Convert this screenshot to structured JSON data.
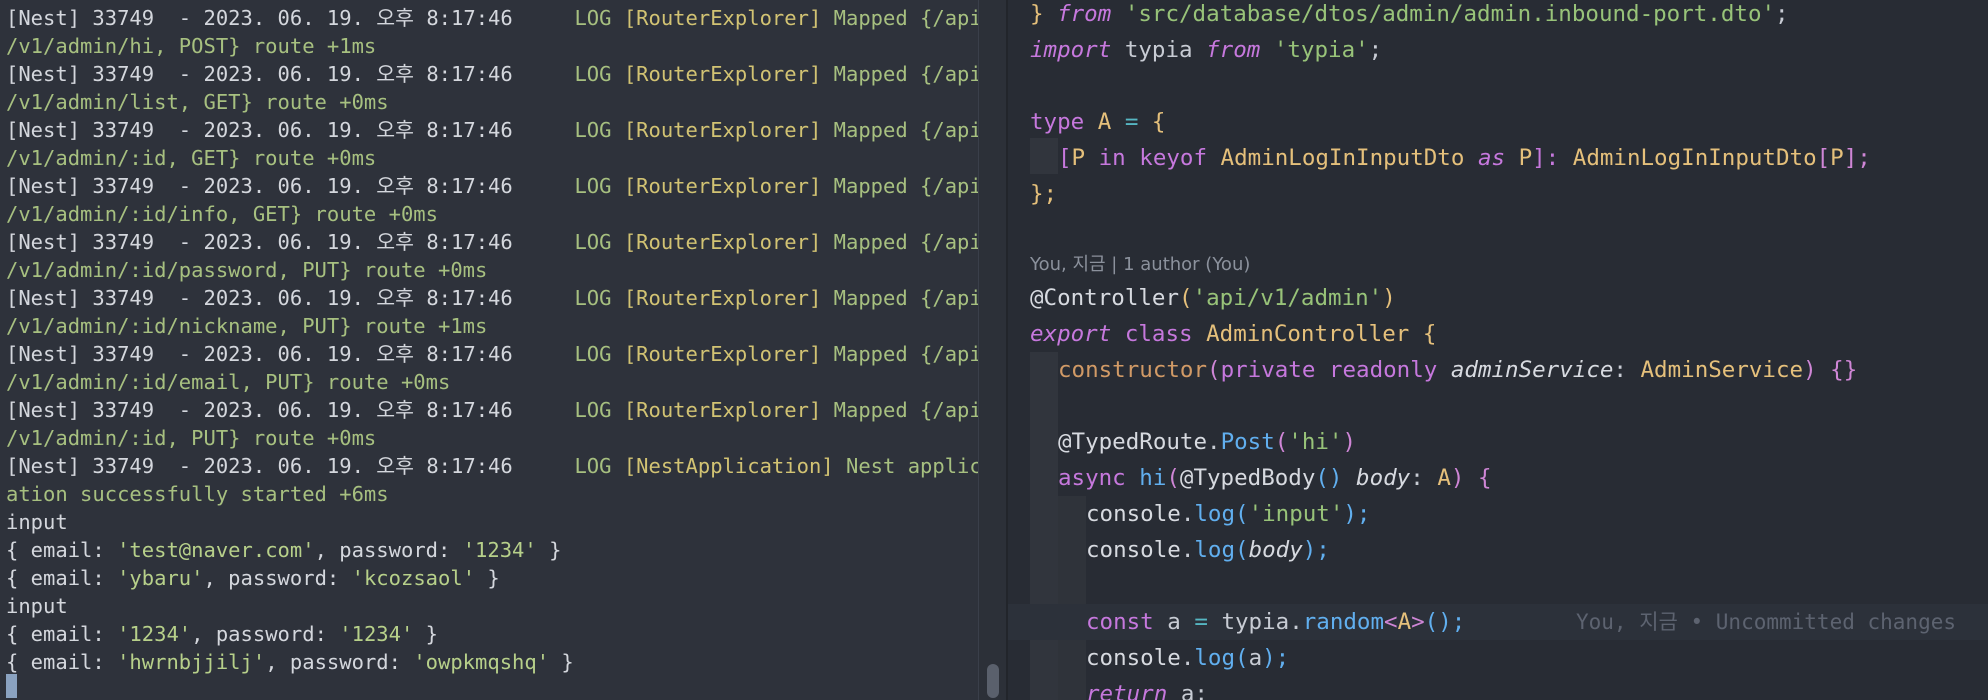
{
  "terminal": {
    "log_lines": [
      {
        "prefix": "[Nest] 33749  - 2023. 06. 19. 오후 8:17:46     ",
        "level": "LOG ",
        "context": "[RouterExplorer]",
        "msg": " Mapped {/api"
      },
      {
        "plain": "/v1/admin/hi, POST} route +1ms"
      },
      {
        "prefix": "[Nest] 33749  - 2023. 06. 19. 오후 8:17:46     ",
        "level": "LOG ",
        "context": "[RouterExplorer]",
        "msg": " Mapped {/api"
      },
      {
        "plain": "/v1/admin/list, GET} route +0ms"
      },
      {
        "prefix": "[Nest] 33749  - 2023. 06. 19. 오후 8:17:46     ",
        "level": "LOG ",
        "context": "[RouterExplorer]",
        "msg": " Mapped {/api"
      },
      {
        "plain": "/v1/admin/:id, GET} route +0ms"
      },
      {
        "prefix": "[Nest] 33749  - 2023. 06. 19. 오후 8:17:46     ",
        "level": "LOG ",
        "context": "[RouterExplorer]",
        "msg": " Mapped {/api"
      },
      {
        "plain": "/v1/admin/:id/info, GET} route +0ms"
      },
      {
        "prefix": "[Nest] 33749  - 2023. 06. 19. 오후 8:17:46     ",
        "level": "LOG ",
        "context": "[RouterExplorer]",
        "msg": " Mapped {/api"
      },
      {
        "plain": "/v1/admin/:id/password, PUT} route +0ms"
      },
      {
        "prefix": "[Nest] 33749  - 2023. 06. 19. 오후 8:17:46     ",
        "level": "LOG ",
        "context": "[RouterExplorer]",
        "msg": " Mapped {/api"
      },
      {
        "plain": "/v1/admin/:id/nickname, PUT} route +1ms"
      },
      {
        "prefix": "[Nest] 33749  - 2023. 06. 19. 오후 8:17:46     ",
        "level": "LOG ",
        "context": "[RouterExplorer]",
        "msg": " Mapped {/api"
      },
      {
        "plain": "/v1/admin/:id/email, PUT} route +0ms"
      },
      {
        "prefix": "[Nest] 33749  - 2023. 06. 19. 오후 8:17:46     ",
        "level": "LOG ",
        "context": "[RouterExplorer]",
        "msg": " Mapped {/api"
      },
      {
        "plain": "/v1/admin/:id, PUT} route +0ms"
      },
      {
        "prefix": "[Nest] 33749  - 2023. 06. 19. 오후 8:17:46     ",
        "level": "LOG ",
        "context": "[NestApplication]",
        "msg": " Nest applic"
      },
      {
        "plain": "ation successfully started +6ms"
      }
    ],
    "output": {
      "input1": "input",
      "obj1": {
        "open": "{ email: ",
        "email": "'test@naver.com'",
        "mid": ", password: ",
        "pw": "'1234'",
        "close": " }"
      },
      "obj2": {
        "open": "{ email: ",
        "email": "'ybaru'",
        "mid": ", password: ",
        "pw": "'kcozsaol'",
        "close": " }"
      },
      "input2": "input",
      "obj3": {
        "open": "{ email: ",
        "email": "'1234'",
        "mid": ", password: ",
        "pw": "'1234'",
        "close": " }"
      },
      "obj4": {
        "open": "{ email: ",
        "email": "'hwrnbjjilj'",
        "mid": ", password: ",
        "pw": "'owpkmqshq'",
        "close": " }"
      }
    }
  },
  "editor": {
    "l1": {
      "a": "} ",
      "b": "from",
      "c": " ",
      "d": "'src/database/dtos/admin/admin.inbound-port.dto'",
      "e": ";"
    },
    "l2": {
      "a": "import",
      "b": " typia ",
      "c": "from",
      "d": " ",
      "e": "'typia'",
      "f": ";"
    },
    "l3": {
      "a": "type",
      "b": " A ",
      "c": "=",
      "d": " {"
    },
    "l4": {
      "a": "[",
      "b": "P",
      "c": " in ",
      "d": "keyof",
      "e": " AdminLogInInputDto ",
      "f": "as",
      "g": " P",
      "h": "]: ",
      "i": "AdminLogInInputDto",
      "j": "[",
      "k": "P",
      "l": "];"
    },
    "l5": {
      "a": "};"
    },
    "blame_header": "You, 지금 | 1 author (You)",
    "l6": {
      "a": "@Controller",
      "b": "(",
      "c": "'api/v1/admin'",
      "d": ")"
    },
    "l7": {
      "a": "export",
      "b": " class ",
      "c": "AdminController",
      "d": " {"
    },
    "l8": {
      "a": "constructor",
      "b": "(",
      "c": "private",
      "d": " ",
      "e": "readonly",
      "f": " ",
      "g": "adminService",
      "h": ": ",
      "i": "AdminService",
      "j": ") {}"
    },
    "l9": {
      "a": "@TypedRoute",
      "b": ".",
      "c": "Post",
      "d": "(",
      "e": "'hi'",
      "f": ")"
    },
    "l10": {
      "a": "async",
      "b": " ",
      "c": "hi",
      "d": "(",
      "e": "@TypedBody",
      "f": "() ",
      "g": "body",
      "h": ": ",
      "i": "A",
      "j": ") {"
    },
    "l11": {
      "a": "console",
      "b": ".",
      "c": "log",
      "d": "(",
      "e": "'input'",
      "f": ");"
    },
    "l12": {
      "a": "console",
      "b": ".",
      "c": "log",
      "d": "(",
      "e": "body",
      "f": ");"
    },
    "l13": {
      "a": "const",
      "b": " a ",
      "c": "=",
      "d": " typia",
      "e": ".",
      "f": "random",
      "g": "<",
      "h": "A",
      "i": ">",
      "j": "();"
    },
    "l14": {
      "a": "console",
      "b": ".",
      "c": "log",
      "d": "(",
      "e": "a",
      "f": ");"
    },
    "l15": {
      "a": "return",
      "b": " a;"
    },
    "inline_blame": "You, 지금 • Uncommitted changes"
  }
}
